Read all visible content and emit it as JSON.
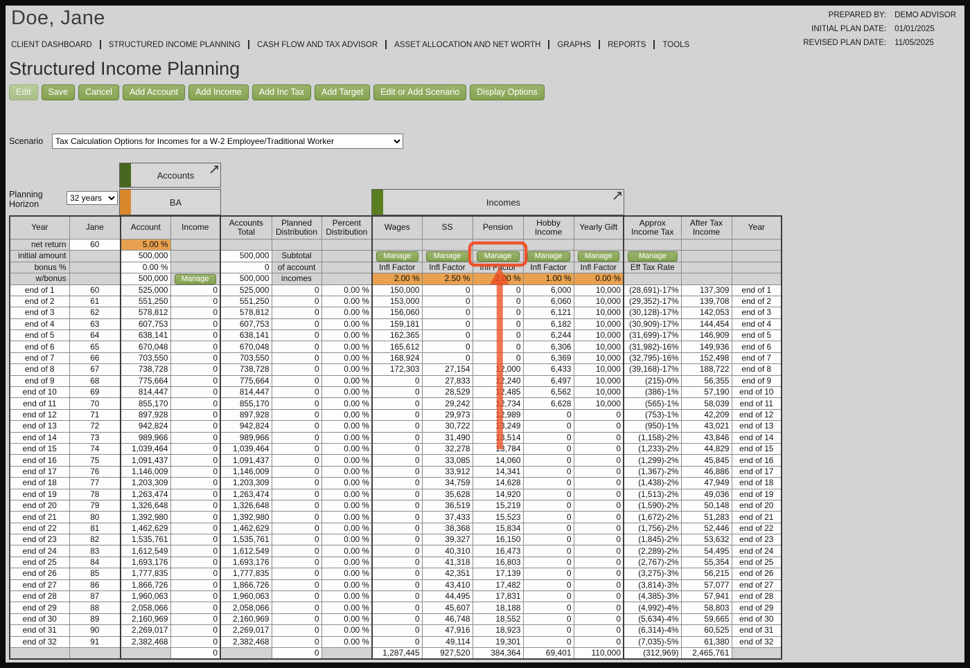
{
  "client_name": "Doe, Jane",
  "meta": {
    "rows": [
      {
        "label": "PREPARED BY:",
        "value": "DEMO ADVISOR"
      },
      {
        "label": "INITIAL PLAN DATE:",
        "value": "01/01/2025"
      },
      {
        "label": "REVISED PLAN DATE:",
        "value": "11/05/2025"
      }
    ]
  },
  "nav": {
    "items": [
      "CLIENT DASHBOARD",
      "STRUCTURED INCOME PLANNING",
      "CASH FLOW AND TAX ADVISOR",
      "ASSET ALLOCATION AND NET WORTH",
      "GRAPHS",
      "REPORTS",
      "TOOLS"
    ]
  },
  "page_title": "Structured Income Planning",
  "toolbar": {
    "buttons": [
      "Edit",
      "Save",
      "Cancel",
      "Add Account",
      "Add Income",
      "Add Inc Tax",
      "Add Target",
      "Edit or Add Scenario",
      "Display Options"
    ]
  },
  "scenario": {
    "label": "Scenario",
    "value": "Tax Calculation Options for Incomes for a W-2 Employee/Traditional Worker"
  },
  "planning_horizon": {
    "label": "Planning Horizon",
    "value": "32 years"
  },
  "groups": {
    "accounts_label": "Accounts",
    "account_name": "BA",
    "incomes_label": "Incomes"
  },
  "table": {
    "headers": [
      "Year",
      "Jane",
      "Account",
      "Income",
      "Accounts Total",
      "Planned Distribution",
      "Percent Distribution",
      "Wages",
      "SS",
      "Pension",
      "Hobby Income",
      "Yearly Gift",
      "Approx Income Tax",
      "After Tax Income",
      "Year"
    ],
    "setup": {
      "row_labels": [
        "net return",
        "initial amount",
        "bonus %",
        "w/bonus"
      ],
      "jane_age": "60",
      "net_return_pct": "5.00 %",
      "initial_amount": "500,000",
      "bonus_pct": "0.00 %",
      "w_bonus_amount": "500,000",
      "accounts_total": {
        "initial": "500,000",
        "bonus": "0",
        "w_bonus": "500,000"
      },
      "distribution_notes": [
        "Subtotal",
        "of account",
        "incomes"
      ],
      "manage_label": "Manage",
      "infl_factor_label": "Infl Factor",
      "eff_tax_rate_label": "Eff Tax Rate",
      "infl_factors": [
        "2.00 %",
        "2.50 %",
        "2.00 %",
        "1.00 %",
        "0.00 %"
      ]
    },
    "rows": [
      [
        "end of 1",
        "60",
        "525,000",
        "0",
        "525,000",
        "0",
        "0.00 %",
        "150,000",
        "0",
        "0",
        "6,000",
        "10,000",
        "(28,691)-17%",
        "137,309",
        "end of 1"
      ],
      [
        "end of 2",
        "61",
        "551,250",
        "0",
        "551,250",
        "0",
        "0.00 %",
        "153,000",
        "0",
        "0",
        "6,060",
        "10,000",
        "(29,352)-17%",
        "139,708",
        "end of 2"
      ],
      [
        "end of 3",
        "62",
        "578,812",
        "0",
        "578,812",
        "0",
        "0.00 %",
        "156,060",
        "0",
        "0",
        "6,121",
        "10,000",
        "(30,128)-17%",
        "142,053",
        "end of 3"
      ],
      [
        "end of 4",
        "63",
        "607,753",
        "0",
        "607,753",
        "0",
        "0.00 %",
        "159,181",
        "0",
        "0",
        "6,182",
        "10,000",
        "(30,909)-17%",
        "144,454",
        "end of 4"
      ],
      [
        "end of 5",
        "64",
        "638,141",
        "0",
        "638,141",
        "0",
        "0.00 %",
        "162,365",
        "0",
        "0",
        "6,244",
        "10,000",
        "(31,699)-17%",
        "146,909",
        "end of 5"
      ],
      [
        "end of 6",
        "65",
        "670,048",
        "0",
        "670,048",
        "0",
        "0.00 %",
        "165,612",
        "0",
        "0",
        "6,306",
        "10,000",
        "(31,982)-16%",
        "149,936",
        "end of 6"
      ],
      [
        "end of 7",
        "66",
        "703,550",
        "0",
        "703,550",
        "0",
        "0.00 %",
        "168,924",
        "0",
        "0",
        "6,369",
        "10,000",
        "(32,795)-16%",
        "152,498",
        "end of 7"
      ],
      [
        "end of 8",
        "67",
        "738,728",
        "0",
        "738,728",
        "0",
        "0.00 %",
        "172,303",
        "27,154",
        "12,000",
        "6,433",
        "10,000",
        "(39,168)-17%",
        "188,722",
        "end of 8"
      ],
      [
        "end of 9",
        "68",
        "775,664",
        "0",
        "775,664",
        "0",
        "0.00 %",
        "0",
        "27,833",
        "12,240",
        "6,497",
        "10,000",
        "(215)-0%",
        "56,355",
        "end of 9"
      ],
      [
        "end of 10",
        "69",
        "814,447",
        "0",
        "814,447",
        "0",
        "0.00 %",
        "0",
        "28,529",
        "12,485",
        "6,562",
        "10,000",
        "(386)-1%",
        "57,190",
        "end of 10"
      ],
      [
        "end of 11",
        "70",
        "855,170",
        "0",
        "855,170",
        "0",
        "0.00 %",
        "0",
        "29,242",
        "12,734",
        "6,628",
        "10,000",
        "(565)-1%",
        "58,039",
        "end of 11"
      ],
      [
        "end of 12",
        "71",
        "897,928",
        "0",
        "897,928",
        "0",
        "0.00 %",
        "0",
        "29,973",
        "12,989",
        "0",
        "0",
        "(753)-1%",
        "42,209",
        "end of 12"
      ],
      [
        "end of 13",
        "72",
        "942,824",
        "0",
        "942,824",
        "0",
        "0.00 %",
        "0",
        "30,722",
        "13,249",
        "0",
        "0",
        "(950)-1%",
        "43,021",
        "end of 13"
      ],
      [
        "end of 14",
        "73",
        "989,966",
        "0",
        "989,966",
        "0",
        "0.00 %",
        "0",
        "31,490",
        "13,514",
        "0",
        "0",
        "(1,158)-2%",
        "43,846",
        "end of 14"
      ],
      [
        "end of 15",
        "74",
        "1,039,464",
        "0",
        "1,039,464",
        "0",
        "0.00 %",
        "0",
        "32,278",
        "13,784",
        "0",
        "0",
        "(1,233)-2%",
        "44,829",
        "end of 15"
      ],
      [
        "end of 16",
        "75",
        "1,091,437",
        "0",
        "1,091,437",
        "0",
        "0.00 %",
        "0",
        "33,085",
        "14,060",
        "0",
        "0",
        "(1,299)-2%",
        "45,845",
        "end of 16"
      ],
      [
        "end of 17",
        "76",
        "1,146,009",
        "0",
        "1,146,009",
        "0",
        "0.00 %",
        "0",
        "33,912",
        "14,341",
        "0",
        "0",
        "(1,367)-2%",
        "46,886",
        "end of 17"
      ],
      [
        "end of 18",
        "77",
        "1,203,309",
        "0",
        "1,203,309",
        "0",
        "0.00 %",
        "0",
        "34,759",
        "14,628",
        "0",
        "0",
        "(1,438)-2%",
        "47,949",
        "end of 18"
      ],
      [
        "end of 19",
        "78",
        "1,263,474",
        "0",
        "1,263,474",
        "0",
        "0.00 %",
        "0",
        "35,628",
        "14,920",
        "0",
        "0",
        "(1,513)-2%",
        "49,036",
        "end of 19"
      ],
      [
        "end of 20",
        "79",
        "1,326,648",
        "0",
        "1,326,648",
        "0",
        "0.00 %",
        "0",
        "36,519",
        "15,219",
        "0",
        "0",
        "(1,590)-2%",
        "50,148",
        "end of 20"
      ],
      [
        "end of 21",
        "80",
        "1,392,980",
        "0",
        "1,392,980",
        "0",
        "0.00 %",
        "0",
        "37,433",
        "15,523",
        "0",
        "0",
        "(1,672)-2%",
        "51,283",
        "end of 21"
      ],
      [
        "end of 22",
        "81",
        "1,462,629",
        "0",
        "1,462,629",
        "0",
        "0.00 %",
        "0",
        "38,368",
        "15,834",
        "0",
        "0",
        "(1,756)-2%",
        "52,446",
        "end of 22"
      ],
      [
        "end of 23",
        "82",
        "1,535,761",
        "0",
        "1,535,761",
        "0",
        "0.00 %",
        "0",
        "39,327",
        "16,150",
        "0",
        "0",
        "(1,845)-2%",
        "53,632",
        "end of 23"
      ],
      [
        "end of 24",
        "83",
        "1,612,549",
        "0",
        "1,612,549",
        "0",
        "0.00 %",
        "0",
        "40,310",
        "16,473",
        "0",
        "0",
        "(2,289)-2%",
        "54,495",
        "end of 24"
      ],
      [
        "end of 25",
        "84",
        "1,693,176",
        "0",
        "1,693,176",
        "0",
        "0.00 %",
        "0",
        "41,318",
        "16,803",
        "0",
        "0",
        "(2,767)-2%",
        "55,354",
        "end of 25"
      ],
      [
        "end of 26",
        "85",
        "1,777,835",
        "0",
        "1,777,835",
        "0",
        "0.00 %",
        "0",
        "42,351",
        "17,139",
        "0",
        "0",
        "(3,275)-3%",
        "56,215",
        "end of 26"
      ],
      [
        "end of 27",
        "86",
        "1,866,726",
        "0",
        "1,866,726",
        "0",
        "0.00 %",
        "0",
        "43,410",
        "17,482",
        "0",
        "0",
        "(3,814)-3%",
        "57,077",
        "end of 27"
      ],
      [
        "end of 28",
        "87",
        "1,960,063",
        "0",
        "1,960,063",
        "0",
        "0.00 %",
        "0",
        "44,495",
        "17,831",
        "0",
        "0",
        "(4,385)-3%",
        "57,941",
        "end of 28"
      ],
      [
        "end of 29",
        "88",
        "2,058,066",
        "0",
        "2,058,066",
        "0",
        "0.00 %",
        "0",
        "45,607",
        "18,188",
        "0",
        "0",
        "(4,992)-4%",
        "58,803",
        "end of 29"
      ],
      [
        "end of 30",
        "89",
        "2,160,969",
        "0",
        "2,160,969",
        "0",
        "0.00 %",
        "0",
        "46,748",
        "18,552",
        "0",
        "0",
        "(5,634)-4%",
        "59,665",
        "end of 30"
      ],
      [
        "end of 31",
        "90",
        "2,269,017",
        "0",
        "2,269,017",
        "0",
        "0.00 %",
        "0",
        "47,916",
        "18,923",
        "0",
        "0",
        "(6,314)-4%",
        "60,525",
        "end of 31"
      ],
      [
        "end of 32",
        "91",
        "2,382,468",
        "0",
        "2,382,468",
        "0",
        "0.00 %",
        "0",
        "49,114",
        "19,301",
        "0",
        "0",
        "(7,035)-5%",
        "61,380",
        "end of 32"
      ]
    ],
    "totals": [
      "",
      "",
      "",
      "0",
      "",
      "0",
      "",
      "1,287,445",
      "927,520",
      "384,364",
      "69,401",
      "110,000",
      "(312,969)",
      "2,465,761",
      ""
    ]
  },
  "annotation": {
    "color": "#ee4e25",
    "target": "manage-pension-button"
  }
}
